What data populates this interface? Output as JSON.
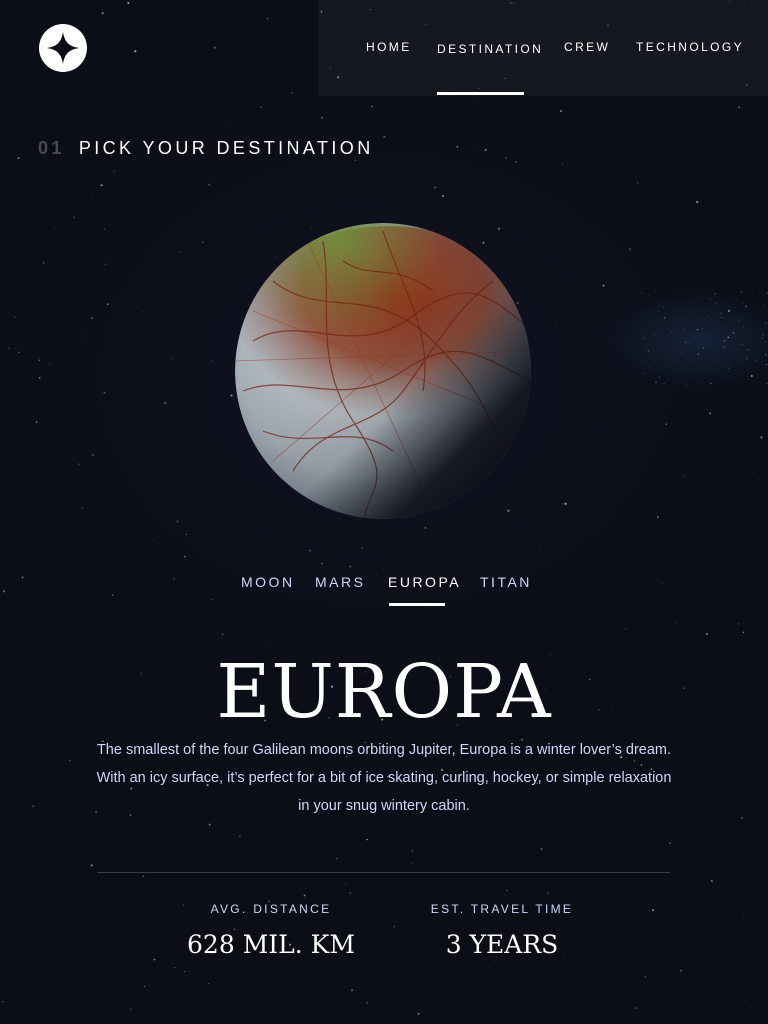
{
  "brand": {
    "logo_icon": "star-icon"
  },
  "nav": {
    "items": [
      {
        "label": "HOME"
      },
      {
        "label": "DESTINATION"
      },
      {
        "label": "CREW"
      },
      {
        "label": "TECHNOLOGY"
      }
    ],
    "active_label": "DESTINATION"
  },
  "page": {
    "number": "01",
    "heading": "PICK YOUR DESTINATION"
  },
  "planet": {
    "image": "europa-moon-image"
  },
  "tabs": {
    "items": [
      {
        "label": "MOON"
      },
      {
        "label": "MARS"
      },
      {
        "label": "EUROPA"
      },
      {
        "label": "TITAN"
      }
    ],
    "active_label": "EUROPA"
  },
  "destination": {
    "name": "EUROPA",
    "description": "The smallest of the four Galilean moons orbiting Jupiter, Europa is a winter lover’s dream. With an icy surface, it’s perfect for a bit of ice skating, curling, hockey, or simple relaxation in your snug wintery cabin.",
    "stats": [
      {
        "label": "AVG. DISTANCE",
        "value": "628 MIL. KM"
      },
      {
        "label": "EST. TRAVEL TIME",
        "value": "3 YEARS"
      }
    ]
  },
  "colors": {
    "background": "#0b0d17",
    "text": "#ffffff",
    "muted_text": "#d0d6f9",
    "divider": "#383b4b"
  }
}
